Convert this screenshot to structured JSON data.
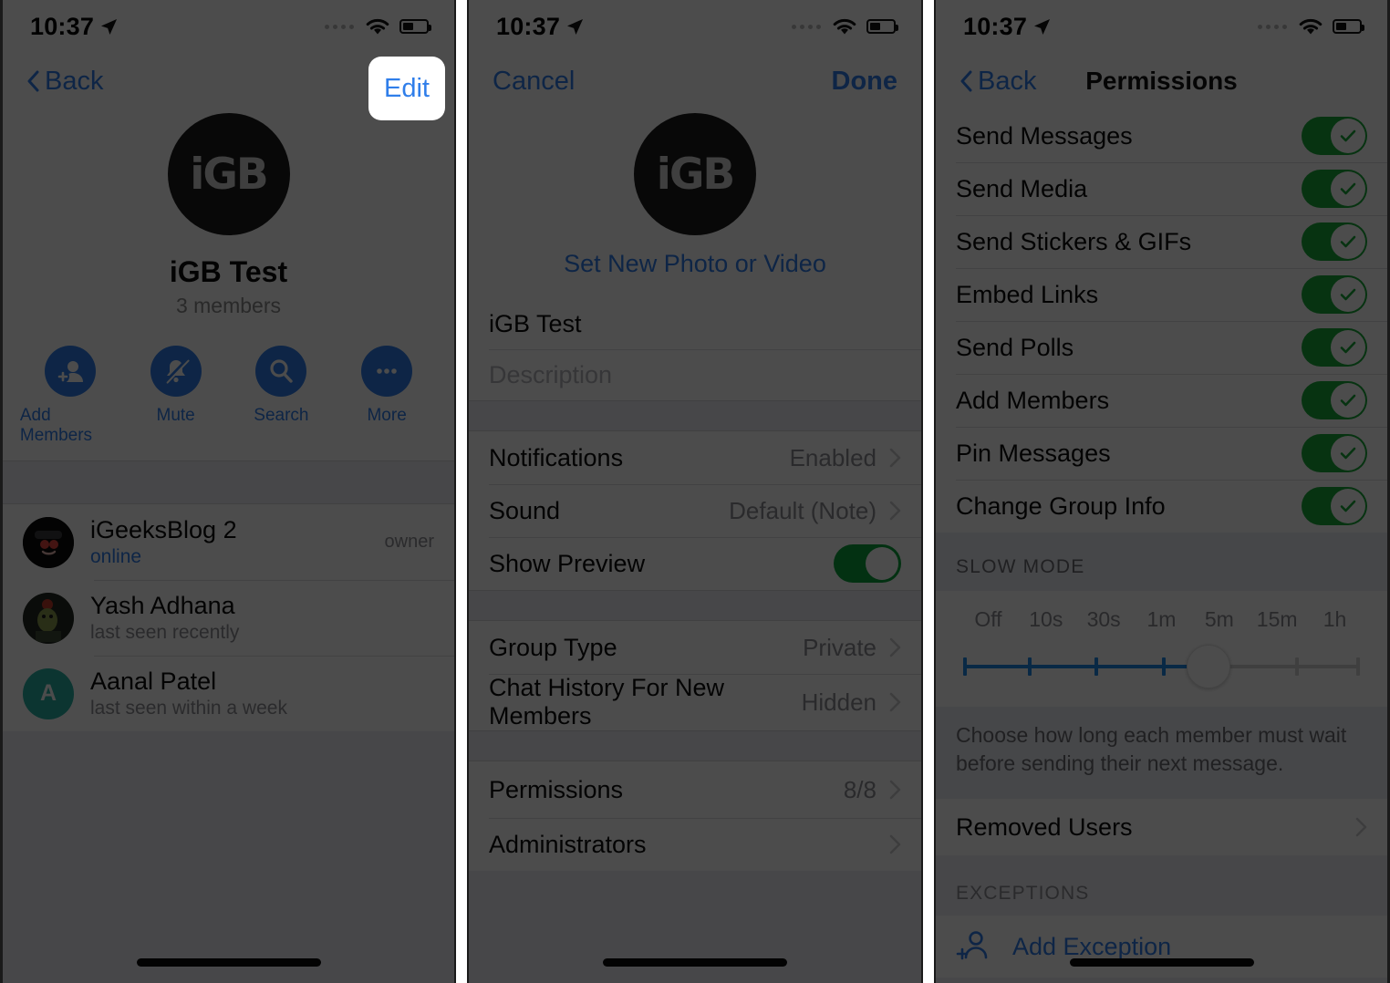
{
  "status_bar": {
    "time": "10:37",
    "icons": [
      "location-arrow-icon",
      "cellular-dots-icon",
      "wifi-icon",
      "battery-icon"
    ]
  },
  "panel1": {
    "nav": {
      "back_label": "Back",
      "edit_label": "Edit"
    },
    "group": {
      "avatar_text": "iGB",
      "name": "iGB Test",
      "members_count": "3 members"
    },
    "actions": [
      {
        "label": "Add Members",
        "icon": "add-person-icon"
      },
      {
        "label": "Mute",
        "icon": "bell-slash-icon"
      },
      {
        "label": "Search",
        "icon": "search-icon"
      },
      {
        "label": "More",
        "icon": "ellipsis-icon"
      }
    ],
    "members": [
      {
        "name": "iGeeksBlog 2",
        "status": "online",
        "status_type": "online",
        "role": "owner",
        "avatar_kind": "photo-dark",
        "avatar_letter": ""
      },
      {
        "name": "Yash Adhana",
        "status": "last seen recently",
        "status_type": "offline",
        "role": "",
        "avatar_kind": "photo",
        "avatar_letter": ""
      },
      {
        "name": "Aanal Patel",
        "status": "last seen within a week",
        "status_type": "offline",
        "role": "",
        "avatar_kind": "initial",
        "avatar_letter": "A"
      }
    ]
  },
  "panel2": {
    "nav": {
      "cancel_label": "Cancel",
      "done_label": "Done"
    },
    "avatar_text": "iGB",
    "set_photo_label": "Set New Photo or Video",
    "name_value": "iGB Test",
    "description_placeholder": "Description",
    "notification_rows": [
      {
        "label": "Notifications",
        "value": "Enabled",
        "type": "chevron"
      },
      {
        "label": "Sound",
        "value": "Default (Note)",
        "type": "chevron"
      },
      {
        "label": "Show Preview",
        "value": "",
        "type": "switch",
        "on": true
      }
    ],
    "group_rows": [
      {
        "label": "Group Type",
        "value": "Private",
        "type": "chevron"
      },
      {
        "label": "Chat History For New Members",
        "value": "Hidden",
        "type": "chevron"
      }
    ],
    "admin_rows": [
      {
        "label": "Permissions",
        "value": "8/8",
        "type": "chevron",
        "highlighted": true
      },
      {
        "label": "Administrators",
        "value": "",
        "type": "chevron",
        "highlighted": false
      }
    ]
  },
  "panel3": {
    "nav": {
      "back_label": "Back",
      "title": "Permissions"
    },
    "permissions": [
      {
        "label": "Send Messages",
        "on": true
      },
      {
        "label": "Send Media",
        "on": true
      },
      {
        "label": "Send Stickers & GIFs",
        "on": true
      },
      {
        "label": "Embed Links",
        "on": true
      },
      {
        "label": "Send Polls",
        "on": true
      },
      {
        "label": "Add Members",
        "on": true
      },
      {
        "label": "Pin Messages",
        "on": true
      },
      {
        "label": "Change Group Info",
        "on": true
      }
    ],
    "slow_mode": {
      "header": "SLOW MODE",
      "ticks": [
        "Off",
        "10s",
        "30s",
        "1m",
        "5m",
        "15m",
        "1h"
      ],
      "selected": "5m",
      "selected_index": 4,
      "note": "Choose how long each member must wait before sending their next message.",
      "fill_color": "#1e8ae8",
      "track_color": "#d4d4d4"
    },
    "removed_users_label": "Removed Users",
    "exceptions_header": "EXCEPTIONS",
    "add_exception_label": "Add Exception",
    "add_exception_icon": "add-person-outline-icon"
  },
  "colors": {
    "accent_blue": "#2f7eea",
    "switch_green": "#1aab3a",
    "group_bg": "#efeff4"
  }
}
